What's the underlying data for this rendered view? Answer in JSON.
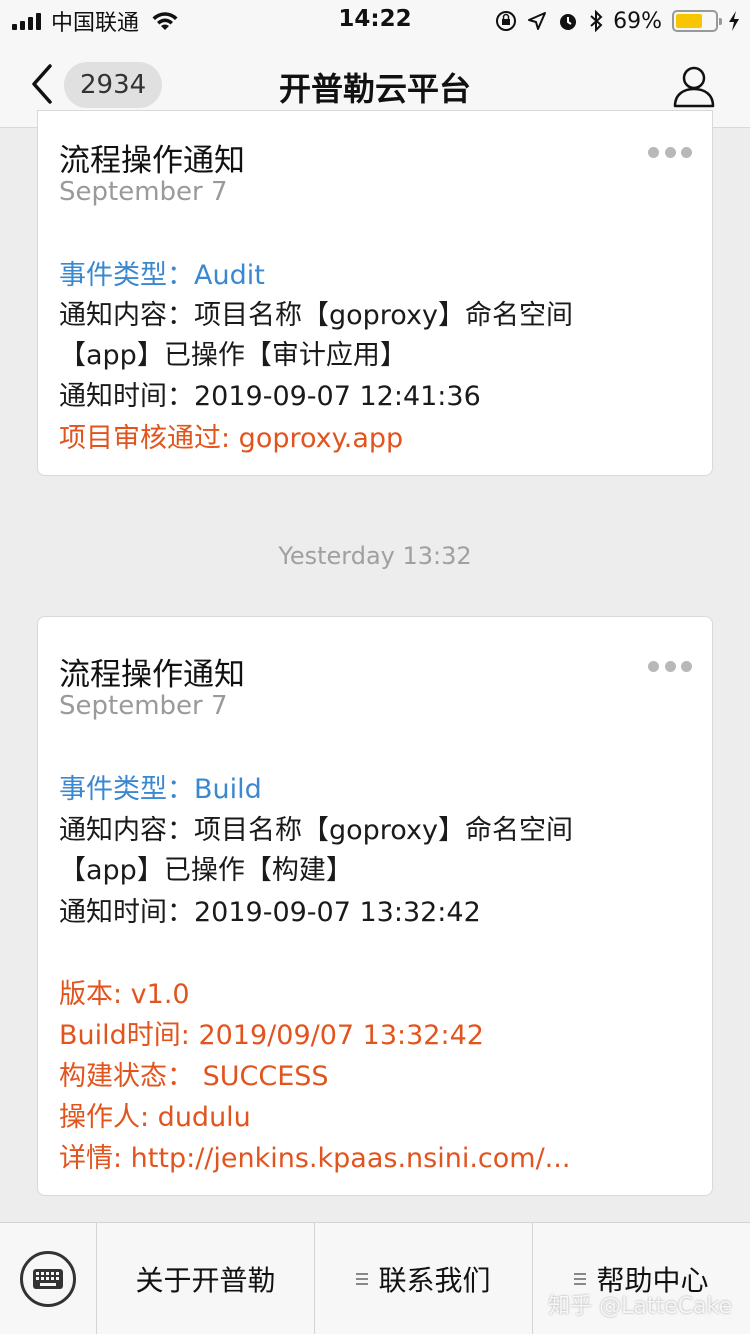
{
  "status_bar": {
    "carrier": "中国联通",
    "time": "14:22",
    "battery": "69%",
    "battery_level": 0.69
  },
  "nav": {
    "unread_badge": "2934",
    "title": "开普勒云平台"
  },
  "cards": [
    {
      "title": "流程操作通知",
      "date": "September 7",
      "event_type": "事件类型：Audit",
      "content_line1": "通知内容：项目名称【goproxy】命名空间",
      "content_line2": "【app】已操作【审计应用】",
      "time": "通知时间：2019-09-07 12:41:36",
      "result": "项目审核通过: goproxy.app"
    },
    {
      "title": "流程操作通知",
      "date": "September 7",
      "event_type": "事件类型：Build",
      "content_line1": "通知内容：项目名称【goproxy】命名空间",
      "content_line2": "【app】已操作【构建】",
      "time": "通知时间：2019-09-07 13:32:42",
      "version": "版本: v1.0",
      "build_time": "Build时间: 2019/09/07 13:32:42",
      "build_status": "构建状态：  SUCCESS",
      "operator": "操作人: dudulu",
      "details": "详情: http://jenkins.kpaas.nsini.com/..."
    }
  ],
  "time_divider": "Yesterday 13:32",
  "bottom_menu": {
    "item1": "关于开普勒",
    "item2": "联系我们",
    "item3": "帮助中心"
  },
  "watermark": "知乎 @LatteCake"
}
